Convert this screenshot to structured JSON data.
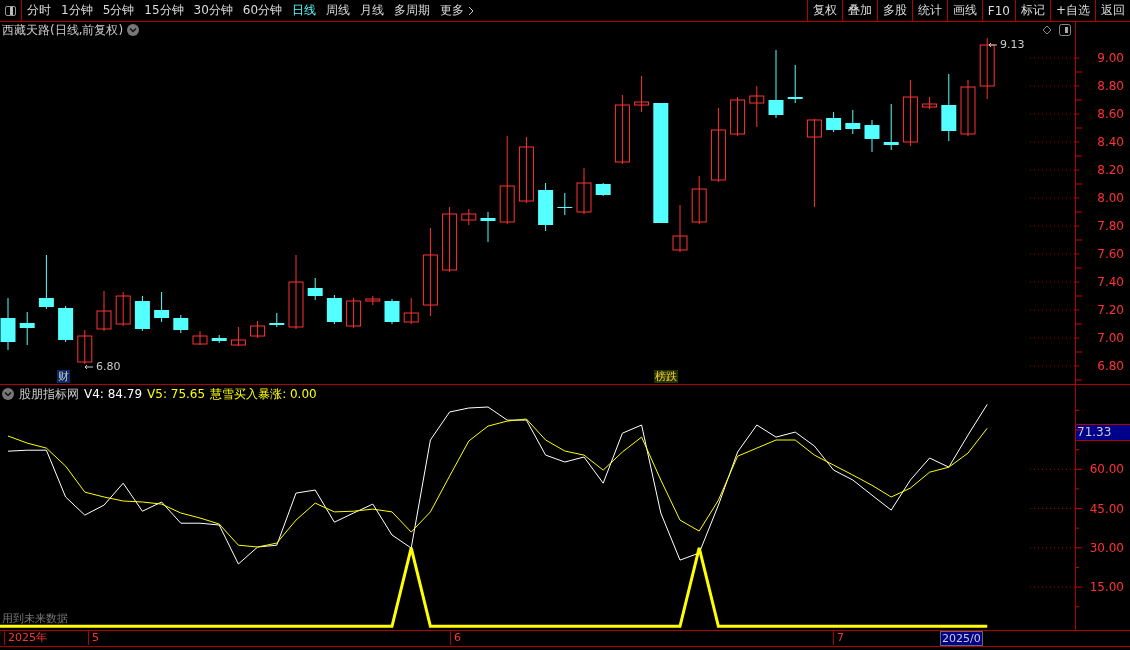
{
  "toolbar": {
    "tabs": [
      {
        "label": "分时",
        "selected": false
      },
      {
        "label": "1分钟",
        "selected": false
      },
      {
        "label": "5分钟",
        "selected": false
      },
      {
        "label": "15分钟",
        "selected": false
      },
      {
        "label": "30分钟",
        "selected": false
      },
      {
        "label": "60分钟",
        "selected": false
      },
      {
        "label": "日线",
        "selected": true
      },
      {
        "label": "周线",
        "selected": false
      },
      {
        "label": "月线",
        "selected": false
      },
      {
        "label": "多周期",
        "selected": false
      }
    ],
    "more": "更多",
    "buttons": [
      "复权",
      "叠加",
      "多股",
      "统计",
      "画线",
      "F10",
      "标记",
      "+自选",
      "返回"
    ]
  },
  "main_chart": {
    "title": "西藏天路(日线,前复权)",
    "high_label": "9.13",
    "low_label": "6.80",
    "markers": [
      {
        "text": "财"
      },
      {
        "text": "榜跌"
      }
    ],
    "price_ticks": [
      "9.00",
      "8.80",
      "8.60",
      "8.40",
      "8.20",
      "8.00",
      "7.80",
      "7.60",
      "7.40",
      "7.20",
      "7.00",
      "6.80"
    ]
  },
  "indicator": {
    "name": "股朋指标网",
    "legend": [
      {
        "text": "V4: 84.79",
        "color": "#ffffff"
      },
      {
        "text": "V5: 75.65",
        "color": "#ffff00"
      },
      {
        "text": "慧雪买入暴涨: 0.00",
        "color": "#ffff00"
      }
    ],
    "current_value": "71.33",
    "note": "用到未来数据",
    "axis_ticks": [
      "60.00",
      "45.00",
      "30.00",
      "15.00"
    ]
  },
  "date_axis": {
    "labels": [
      "2025年",
      "5",
      "6",
      "7"
    ],
    "current": "2025/0"
  }
}
